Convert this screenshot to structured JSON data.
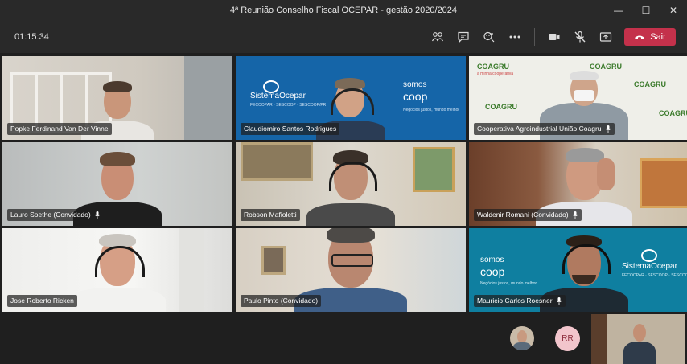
{
  "window": {
    "title": "4ª Reunião Conselho Fiscal OCEPAR - gestão 2020/2024",
    "minimize": "—",
    "maximize": "☐",
    "close": "✕"
  },
  "toolbar": {
    "timer": "01:15:34",
    "leave_label": "Sair"
  },
  "participants": [
    {
      "name": "Popke Ferdinand Van Der Vinne",
      "mic": false
    },
    {
      "name": "Claudiomiro Santos Rodrigues",
      "mic": false
    },
    {
      "name": "Cooperativa Agroindustrial União Coagru",
      "mic": true
    },
    {
      "name": "Lauro Soethe (Convidado)",
      "mic": true
    },
    {
      "name": "Robson Mafioletti",
      "mic": false
    },
    {
      "name": "Waldenir Romani (Convidado)",
      "mic": true
    },
    {
      "name": "Jose Roberto Ricken",
      "mic": false
    },
    {
      "name": "Paulo Pinto (Convidado)",
      "mic": false
    },
    {
      "name": "Mauricio Carlos Roesner",
      "mic": true
    }
  ],
  "backgrounds": {
    "sistema_ocepar": "SistemaOcepar",
    "sistema_sub": "FECOOPAR · SESCOOP · SESCOOP/PR",
    "somos_coop_1": "somos",
    "somos_coop_2": "coop",
    "somos_sub": "Negócios justos, mundo melhor",
    "coagru": "COAGRU",
    "coagru_sub": "a minha cooperativa"
  },
  "bottom": {
    "initials": "RR"
  },
  "colors": {
    "leave": "#c4314b",
    "ocepar_blue": "#1565a8",
    "coop_teal": "#0f7fa0",
    "coagru_green": "#3a7a2a"
  }
}
